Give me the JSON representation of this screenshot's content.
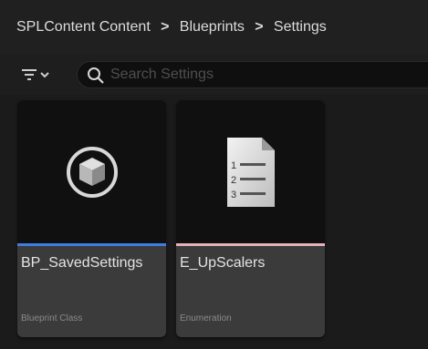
{
  "breadcrumb": {
    "items": [
      "SPLContent Content",
      "Blueprints",
      "Settings"
    ],
    "separator": ">"
  },
  "toolbar": {
    "filter_icon": "filter-lines-icon",
    "search_placeholder": "Search Settings",
    "search_value": ""
  },
  "assets": [
    {
      "name": "BP_SavedSettings",
      "type": "Blueprint Class",
      "icon": "blueprint-cube-icon",
      "type_color": "#3c7fe0"
    },
    {
      "name": "E_UpScalers",
      "type": "Enumeration",
      "icon": "enum-list-document-icon",
      "type_color": "#e8b0b8"
    }
  ],
  "colors": {
    "background": "#1b1b1b",
    "header": "#202020",
    "tile": "#3b3b3b",
    "thumbnail": "#101010"
  }
}
